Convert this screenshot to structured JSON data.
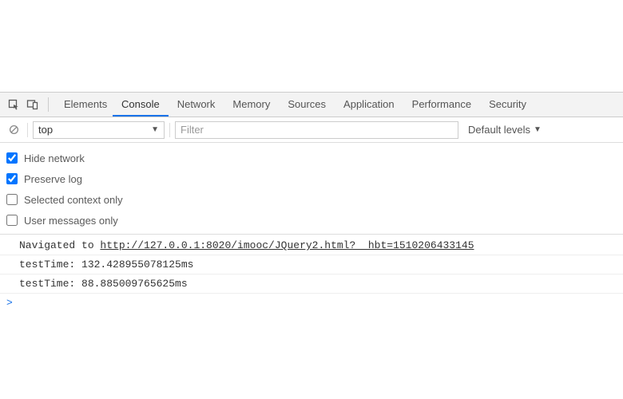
{
  "tabs": {
    "items": [
      {
        "label": "Elements"
      },
      {
        "label": "Console"
      },
      {
        "label": "Network"
      },
      {
        "label": "Memory"
      },
      {
        "label": "Sources"
      },
      {
        "label": "Application"
      },
      {
        "label": "Performance"
      },
      {
        "label": "Security"
      }
    ],
    "active_index": 1
  },
  "toolbar": {
    "context_selected": "top",
    "filter_placeholder": "Filter",
    "filter_value": "",
    "levels_label": "Default levels"
  },
  "options": [
    {
      "label": "Hide network",
      "checked": true
    },
    {
      "label": "Preserve log",
      "checked": true
    },
    {
      "label": "Selected context only",
      "checked": false
    },
    {
      "label": "User messages only",
      "checked": false
    }
  ],
  "console": {
    "nav_prefix": "Navigated to ",
    "nav_url": "http://127.0.0.1:8020/imooc/JQuery2.html?__hbt=1510206433145",
    "lines": [
      "testTime: 132.428955078125ms",
      "testTime: 88.885009765625ms"
    ],
    "prompt": ">"
  },
  "icons": {
    "inspect": "inspect-icon",
    "device": "device-icon",
    "clear": "clear-icon"
  }
}
